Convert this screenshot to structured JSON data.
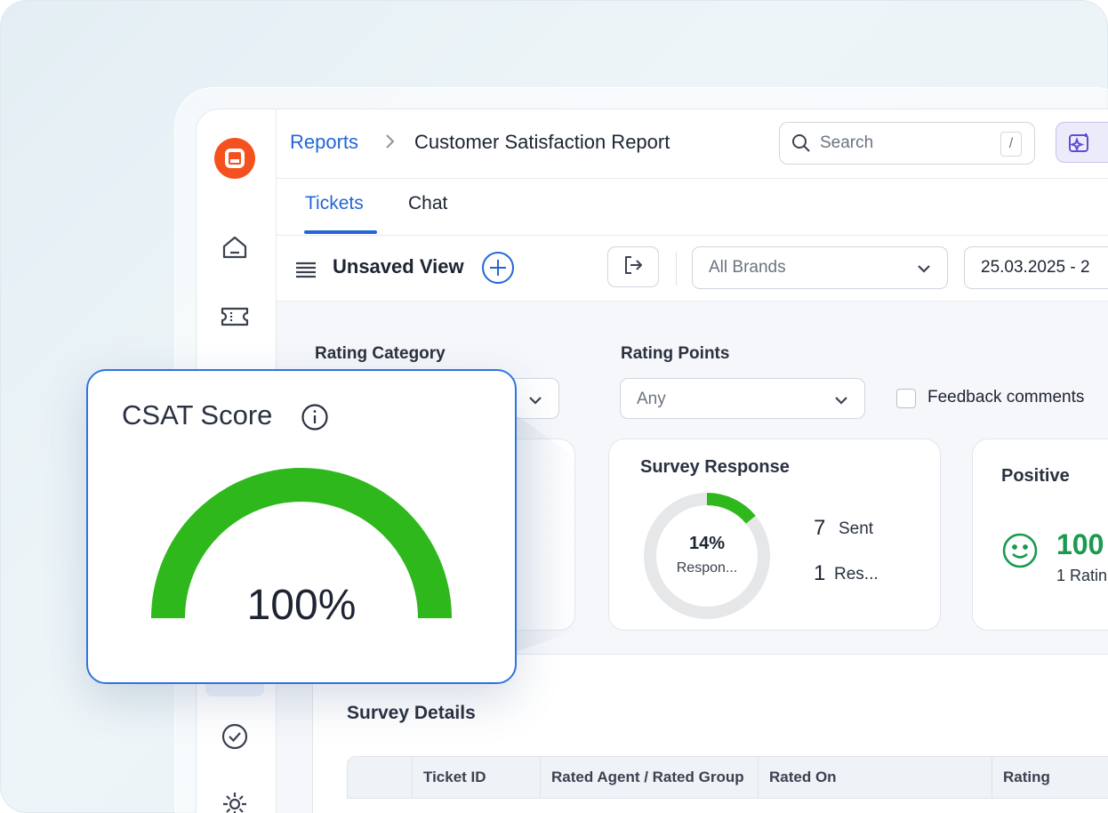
{
  "breadcrumb": {
    "parent": "Reports",
    "current": "Customer Satisfaction Report"
  },
  "search": {
    "placeholder": "Search",
    "shortcut": "/"
  },
  "tabs": [
    {
      "label": "Tickets"
    },
    {
      "label": "Chat"
    }
  ],
  "view": {
    "title": "Unsaved View"
  },
  "filters": {
    "brands": "All Brands",
    "date_range": "25.03.2025 - 2",
    "rating_category_label": "Rating Category",
    "rating_points_label": "Rating Points",
    "rating_points_value": "Any",
    "feedback_label": "Feedback comments"
  },
  "survey_response": {
    "title": "Survey Response",
    "percent": "14%",
    "percent_label": "Respon...",
    "percent_value": 14,
    "sent_count": "7",
    "sent_label": "Sent",
    "responded_count": "1",
    "responded_label": "Res..."
  },
  "positive": {
    "title": "Positive",
    "value": "100",
    "sub": "1 Ratin"
  },
  "survey_details": {
    "title": "Survey Details",
    "columns": [
      "Ticket ID",
      "Rated Agent / Rated Group",
      "Rated On",
      "Rating"
    ]
  },
  "csat": {
    "title": "CSAT Score",
    "value": "100%",
    "value_num": 100
  },
  "colors": {
    "accent": "#2266d6",
    "brand": "#f4511e",
    "gauge": "#2eb81c",
    "positive": "#1a9a4e"
  }
}
